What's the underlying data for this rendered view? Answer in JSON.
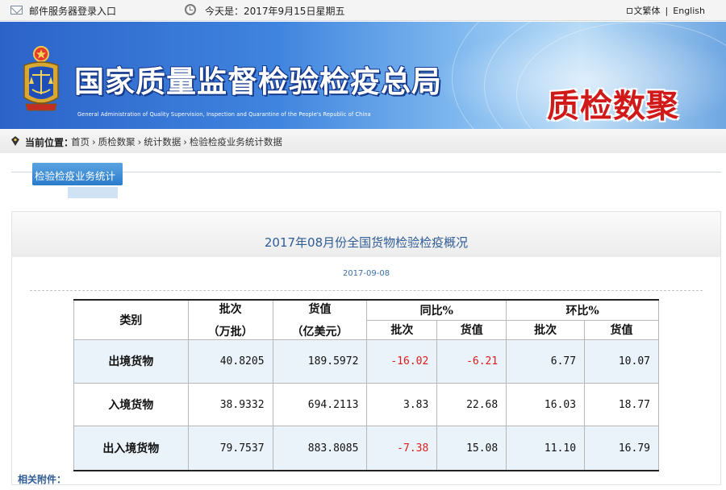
{
  "topbar": {
    "mail_label": "邮件服务器登录入口",
    "date_text": "今天是：2017年9月15日星期五",
    "lang_traditional": "文繁体",
    "lang_separator": "|",
    "lang_english": "English"
  },
  "banner": {
    "org_name": "国家质量监督检验检疫总局",
    "org_name_en": "General Administration of Quality Supervision, Inspection and Quarantine of the People's Republic of China",
    "brand_title": "质检数聚",
    "colors": {
      "brand_red": "#d01a1a",
      "banner_blue": "#3f84de"
    }
  },
  "breadcrumb": {
    "label": "当前位置：",
    "items": [
      "首页",
      "质检数聚",
      "统计数据",
      "检验检疫业务统计数据"
    ],
    "separator": "›"
  },
  "section": {
    "tab_label": "检验检疫业务统计"
  },
  "article": {
    "title": "2017年08月份全国货物检验检疫概况",
    "date": "2017-09-08",
    "attachments_label": "相关附件："
  },
  "table": {
    "header_category": "类别",
    "header_batches": "批次",
    "header_batches_unit": "（万批）",
    "header_value": "货值",
    "header_value_unit": "（亿美元）",
    "header_yoy": "同比%",
    "header_mom": "环比%",
    "sub_batches": "批次",
    "sub_value": "货值",
    "rows": [
      {
        "category": "出境货物",
        "batches": "40.8205",
        "value": "189.5972",
        "yoy_batches": "-16.02",
        "yoy_value": "-6.21",
        "mom_batches": "6.77",
        "mom_value": "10.07"
      },
      {
        "category": "入境货物",
        "batches": "38.9332",
        "value": "694.2113",
        "yoy_batches": "3.83",
        "yoy_value": "22.68",
        "mom_batches": "16.03",
        "mom_value": "18.77"
      },
      {
        "category": "出入境货物",
        "batches": "79.7537",
        "value": "883.8085",
        "yoy_batches": "-7.38",
        "yoy_value": "15.08",
        "mom_batches": "11.10",
        "mom_value": "16.79"
      }
    ],
    "colors": {
      "negative": "#e01b1b",
      "row_shade": "#eaf3fa"
    }
  }
}
